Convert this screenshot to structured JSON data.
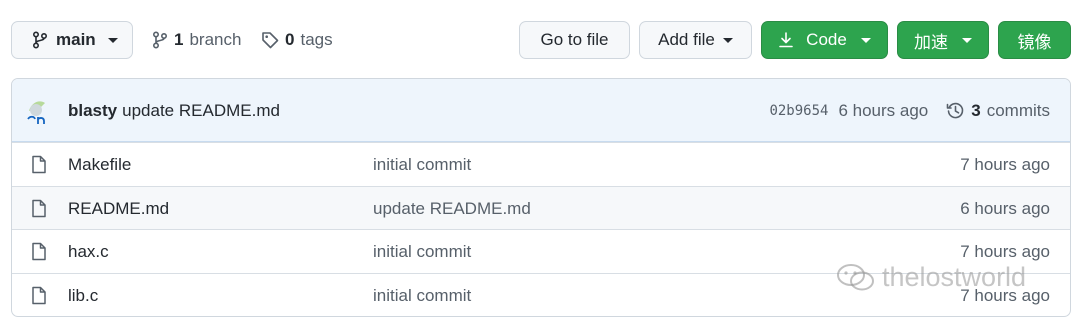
{
  "toolbar": {
    "branch_button_label": "main",
    "branch_count": "1",
    "branch_label": "branch",
    "tag_count": "0",
    "tag_label": "tags",
    "go_to_file_label": "Go to file",
    "add_file_label": "Add file",
    "code_label": "Code",
    "accelerate_label": "加速",
    "mirror_label": "镜像"
  },
  "latest_commit": {
    "author": "blasty",
    "message": "update README.md",
    "sha": "02b9654",
    "time": "6 hours ago",
    "commit_count": "3",
    "commit_label": "commits"
  },
  "files": [
    {
      "name": "Makefile",
      "message": "initial commit",
      "time": "7 hours ago"
    },
    {
      "name": "README.md",
      "message": "update README.md",
      "time": "6 hours ago"
    },
    {
      "name": "hax.c",
      "message": "initial commit",
      "time": "7 hours ago"
    },
    {
      "name": "lib.c",
      "message": "initial commit",
      "time": "7 hours ago"
    }
  ],
  "watermark": {
    "text": "thelostworld"
  },
  "colors": {
    "accent_green": "#2da44e",
    "commit_bar": "#eef5fc",
    "border": "#d0d7de"
  }
}
